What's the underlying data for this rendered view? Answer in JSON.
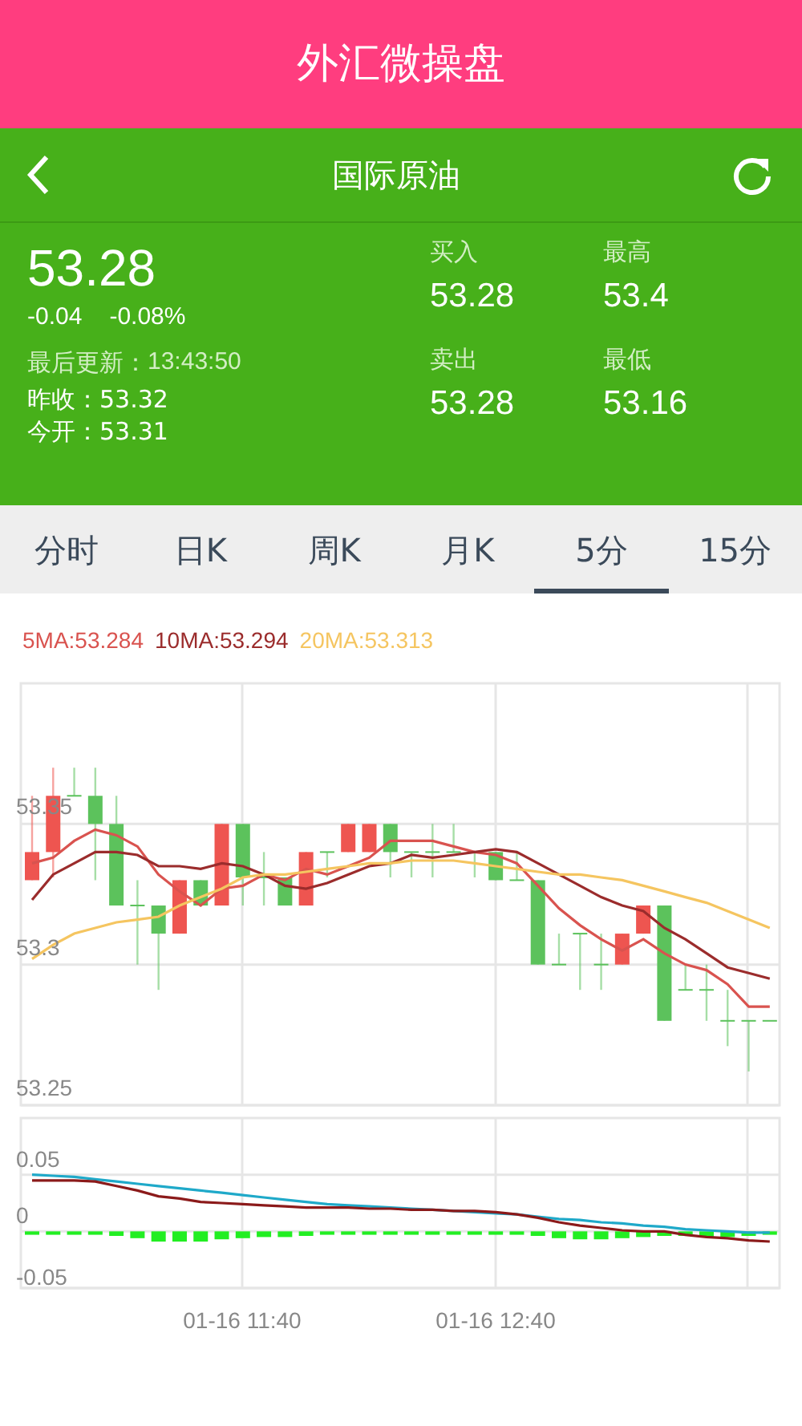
{
  "app_bar": {
    "title": "外汇微操盘"
  },
  "nav": {
    "title": "国际原油"
  },
  "quote": {
    "price": "53.28",
    "change": "-0.04",
    "change_pct": "-0.08%",
    "updated_label": "最后更新：",
    "updated_time": "13:43:50",
    "prev_close": "昨收：53.32",
    "open": "今开：53.31",
    "stats": [
      {
        "label": "买入",
        "value": "53.28"
      },
      {
        "label": "最高",
        "value": "53.4"
      },
      {
        "label": "卖出",
        "value": "53.28"
      },
      {
        "label": "最低",
        "value": "53.16"
      }
    ]
  },
  "tabs": [
    {
      "label": "分时",
      "selected": false
    },
    {
      "label": "日K",
      "selected": false
    },
    {
      "label": "周K",
      "selected": false
    },
    {
      "label": "月K",
      "selected": false
    },
    {
      "label": "5分",
      "selected": true
    },
    {
      "label": "15分",
      "selected": false
    }
  ],
  "ma_legend": [
    {
      "text": "5MA:53.284",
      "color": "#d9534f"
    },
    {
      "text": "10MA:53.294",
      "color": "#9b2c2c"
    },
    {
      "text": "20MA:53.313",
      "color": "#f5c560"
    }
  ],
  "price_chart": {
    "chart_data": {
      "type": "candlestick",
      "grid": true,
      "ylim": [
        53.25,
        53.4
      ],
      "yticks": [
        {
          "value": 53.25,
          "label": "53.25"
        },
        {
          "value": 53.3,
          "label": "53.3"
        },
        {
          "value": 53.35,
          "label": "53.35"
        }
      ],
      "ohlc": [
        [
          53.33,
          53.36,
          53.33,
          53.34
        ],
        [
          53.34,
          53.37,
          53.331,
          53.36
        ],
        [
          53.36,
          53.37,
          53.36,
          53.36
        ],
        [
          53.36,
          53.37,
          53.33,
          53.35
        ],
        [
          53.35,
          53.36,
          53.321,
          53.321
        ],
        [
          53.321,
          53.33,
          53.3,
          53.321
        ],
        [
          53.321,
          53.321,
          53.291,
          53.311
        ],
        [
          53.311,
          53.33,
          53.311,
          53.33
        ],
        [
          53.33,
          53.33,
          53.321,
          53.321
        ],
        [
          53.321,
          53.35,
          53.321,
          53.35
        ],
        [
          53.35,
          53.35,
          53.321,
          53.331
        ],
        [
          53.331,
          53.34,
          53.321,
          53.331
        ],
        [
          53.331,
          53.331,
          53.321,
          53.321
        ],
        [
          53.321,
          53.34,
          53.321,
          53.34
        ],
        [
          53.34,
          53.34,
          53.331,
          53.34
        ],
        [
          53.34,
          53.35,
          53.34,
          53.35
        ],
        [
          53.34,
          53.35,
          53.34,
          53.35
        ],
        [
          53.35,
          53.35,
          53.331,
          53.34
        ],
        [
          53.34,
          53.34,
          53.331,
          53.34
        ],
        [
          53.34,
          53.35,
          53.331,
          53.34
        ],
        [
          53.34,
          53.35,
          53.34,
          53.34
        ],
        [
          53.34,
          53.34,
          53.331,
          53.34
        ],
        [
          53.34,
          53.34,
          53.33,
          53.33
        ],
        [
          53.33,
          53.34,
          53.33,
          53.33
        ],
        [
          53.33,
          53.33,
          53.3,
          53.3
        ],
        [
          53.3,
          53.311,
          53.3,
          53.3
        ],
        [
          53.311,
          53.311,
          53.291,
          53.311
        ],
        [
          53.3,
          53.311,
          53.291,
          53.3
        ],
        [
          53.3,
          53.311,
          53.3,
          53.311
        ],
        [
          53.311,
          53.321,
          53.311,
          53.321
        ],
        [
          53.321,
          53.321,
          53.28,
          53.28
        ],
        [
          53.291,
          53.3,
          53.291,
          53.291
        ],
        [
          53.291,
          53.3,
          53.28,
          53.291
        ],
        [
          53.28,
          53.291,
          53.271,
          53.28
        ],
        [
          53.28,
          53.28,
          53.262,
          53.28
        ],
        [
          53.28,
          53.28,
          53.28,
          53.28
        ]
      ],
      "series": [
        {
          "type": "line",
          "color": "#d9534f",
          "values": [
            53.336,
            53.338,
            53.344,
            53.348,
            53.346,
            53.342,
            53.332,
            53.326,
            53.321,
            53.327,
            53.328,
            53.332,
            53.33,
            53.334,
            53.332,
            53.335,
            53.338,
            53.344,
            53.344,
            53.344,
            53.342,
            53.34,
            53.339,
            53.336,
            53.328,
            53.32,
            53.314,
            53.309,
            53.305,
            53.309,
            53.304,
            53.3,
            53.298,
            53.293,
            53.285,
            53.285
          ]
        },
        {
          "type": "line",
          "color": "#9b2c2c",
          "values": [
            53.323,
            53.332,
            53.336,
            53.34,
            53.34,
            53.339,
            53.335,
            53.335,
            53.334,
            53.336,
            53.335,
            53.332,
            53.328,
            53.327,
            53.329,
            53.332,
            53.335,
            53.336,
            53.339,
            53.338,
            53.339,
            53.34,
            53.341,
            53.34,
            53.336,
            53.332,
            53.328,
            53.324,
            53.321,
            53.319,
            53.313,
            53.309,
            53.304,
            53.299,
            53.297,
            53.295
          ]
        },
        {
          "type": "line",
          "color": "#f5c560",
          "values": [
            53.302,
            53.307,
            53.311,
            53.313,
            53.315,
            53.316,
            53.317,
            53.321,
            53.324,
            53.327,
            53.331,
            53.332,
            53.332,
            53.333,
            53.334,
            53.335,
            53.336,
            53.336,
            53.337,
            53.337,
            53.337,
            53.336,
            53.335,
            53.334,
            53.333,
            53.332,
            53.332,
            53.331,
            53.33,
            53.328,
            53.326,
            53.324,
            53.322,
            53.319,
            53.316,
            53.313
          ]
        }
      ]
    }
  },
  "indicator_chart": {
    "chart_data": {
      "type": "line",
      "grid": true,
      "ylim": [
        -0.05,
        0.1
      ],
      "yticks": [
        {
          "value": -0.05,
          "label": "-0.05"
        },
        {
          "value": 0,
          "label": "0"
        },
        {
          "value": 0.05,
          "label": "0.05"
        }
      ],
      "series": [
        {
          "type": "bar",
          "color": "#22ee22",
          "values": [
            -0.003,
            -0.003,
            -0.003,
            -0.003,
            -0.004,
            -0.006,
            -0.009,
            -0.009,
            -0.009,
            -0.007,
            -0.006,
            -0.005,
            -0.005,
            -0.004,
            -0.003,
            -0.003,
            -0.003,
            -0.003,
            -0.003,
            -0.003,
            -0.003,
            -0.003,
            -0.003,
            -0.003,
            -0.004,
            -0.006,
            -0.007,
            -0.007,
            -0.006,
            -0.005,
            -0.004,
            -0.004,
            -0.005,
            -0.005,
            -0.004,
            -0.003
          ]
        },
        {
          "color": "#1fa9c9",
          "values": [
            0.05,
            0.049,
            0.048,
            0.046,
            0.044,
            0.042,
            0.04,
            0.038,
            0.036,
            0.034,
            0.032,
            0.03,
            0.028,
            0.026,
            0.024,
            0.023,
            0.022,
            0.021,
            0.02,
            0.019,
            0.018,
            0.017,
            0.016,
            0.015,
            0.013,
            0.011,
            0.01,
            0.008,
            0.007,
            0.005,
            0.004,
            0.002,
            0.001,
            0.0,
            -0.001,
            -0.001
          ]
        },
        {
          "color": "#8b1a1a",
          "values": [
            0.045,
            0.045,
            0.045,
            0.044,
            0.04,
            0.036,
            0.031,
            0.029,
            0.026,
            0.025,
            0.024,
            0.023,
            0.022,
            0.021,
            0.021,
            0.021,
            0.02,
            0.02,
            0.019,
            0.019,
            0.018,
            0.018,
            0.017,
            0.015,
            0.012,
            0.008,
            0.005,
            0.003,
            0.001,
            0.0,
            0.0,
            -0.003,
            -0.005,
            -0.006,
            -0.008,
            -0.009
          ]
        }
      ]
    },
    "time_labels": [
      "01-16 11:40",
      "01-16 12:40"
    ]
  }
}
